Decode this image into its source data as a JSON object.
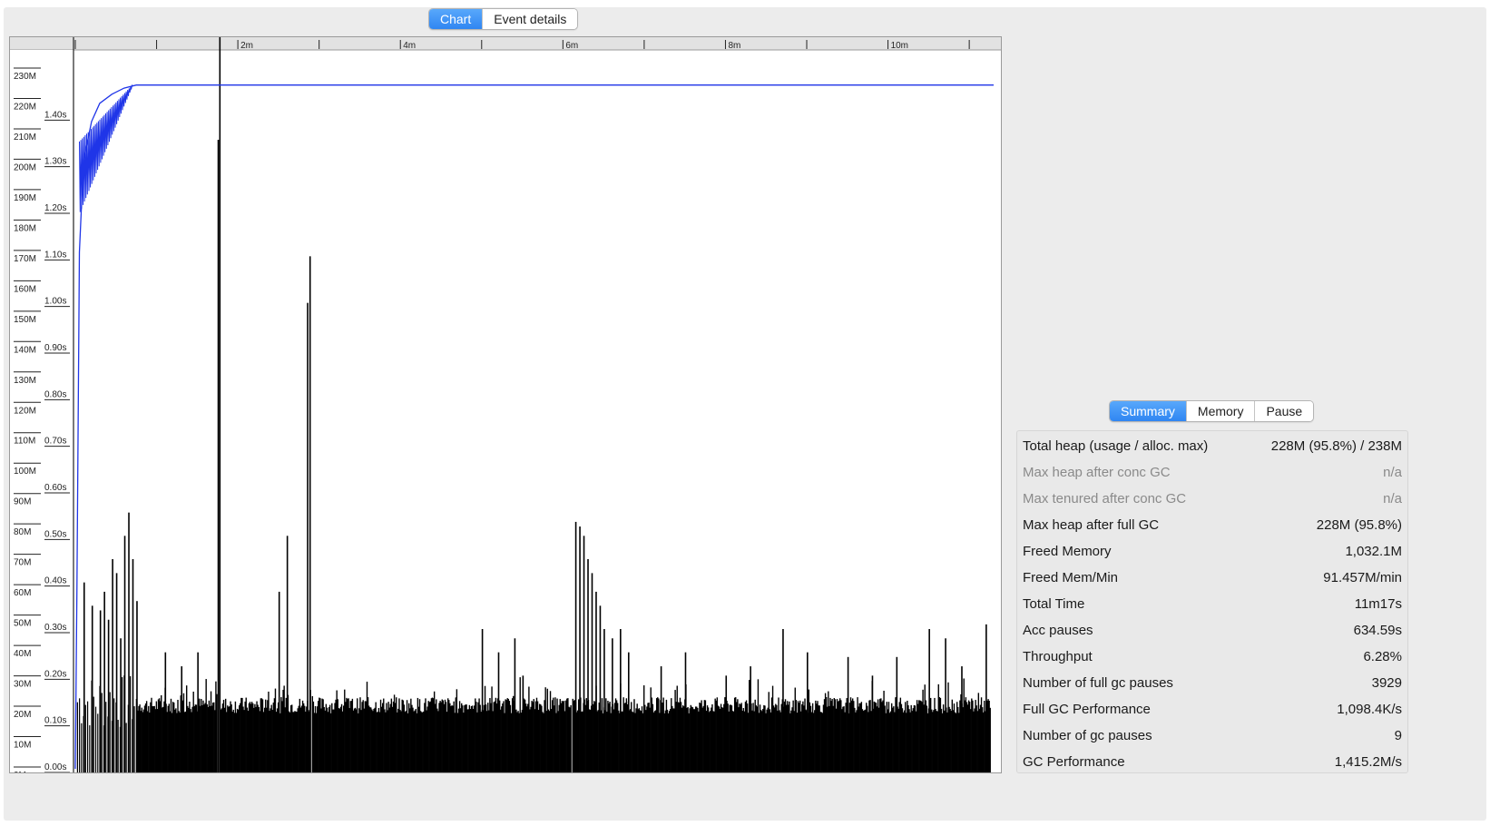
{
  "chart_tabs": [
    {
      "label": "Chart",
      "active": true
    },
    {
      "label": "Event details",
      "active": false
    }
  ],
  "summary_tabs": [
    {
      "label": "Summary",
      "active": true
    },
    {
      "label": "Memory",
      "active": false
    },
    {
      "label": "Pause",
      "active": false
    }
  ],
  "summary": {
    "rows": [
      {
        "label": "Total heap (usage / alloc. max)",
        "value": "228M (95.8%) / 238M",
        "dim": false
      },
      {
        "label": "Max heap after conc GC",
        "value": "n/a",
        "dim": true
      },
      {
        "label": "Max tenured after conc GC",
        "value": "n/a",
        "dim": true
      },
      {
        "label": "Max heap after full GC",
        "value": "228M (95.8%)",
        "dim": false
      },
      {
        "label": "Freed Memory",
        "value": "1,032.1M",
        "dim": false
      },
      {
        "label": "Freed Mem/Min",
        "value": "91.457M/min",
        "dim": false
      },
      {
        "label": "Total Time",
        "value": "11m17s",
        "dim": false
      },
      {
        "label": "Acc pauses",
        "value": "634.59s",
        "dim": false
      },
      {
        "label": "Throughput",
        "value": "6.28%",
        "dim": false
      },
      {
        "label": "Number of full gc pauses",
        "value": "3929",
        "dim": false
      },
      {
        "label": "Full GC Performance",
        "value": "1,098.4K/s",
        "dim": false
      },
      {
        "label": "Number of gc pauses",
        "value": "9",
        "dim": false
      },
      {
        "label": "GC Performance",
        "value": "1,415.2M/s",
        "dim": false
      }
    ]
  },
  "colors": {
    "accent": "#2f86f2",
    "heap_line": "#1f35e8",
    "pause_bars": "#000000"
  },
  "chart_data": {
    "type": "bar",
    "x_unit": "minutes",
    "xlim": [
      0,
      11.3
    ],
    "x_ticks": [
      "",
      "2m",
      "4m",
      "6m",
      "8m",
      "10m"
    ],
    "y_heap_ticks": [
      "0M",
      "10M",
      "20M",
      "30M",
      "40M",
      "50M",
      "60M",
      "70M",
      "80M",
      "90M",
      "100M",
      "110M",
      "120M",
      "130M",
      "140M",
      "150M",
      "160M",
      "170M",
      "180M",
      "190M",
      "200M",
      "210M",
      "220M",
      "230M"
    ],
    "y_heap_lim": [
      0,
      230
    ],
    "y_pause_ticks": [
      "0.00s",
      "0.10s",
      "0.20s",
      "0.30s",
      "0.40s",
      "0.50s",
      "0.60s",
      "0.70s",
      "0.80s",
      "0.90s",
      "1.00s",
      "1.10s",
      "1.20s",
      "1.30s",
      "1.40s"
    ],
    "y_pause_lim": [
      0,
      1.5
    ],
    "series": [
      {
        "kind": "line",
        "points": [
          [
            0.0,
            0
          ],
          [
            0.02,
            60
          ],
          [
            0.05,
            170
          ],
          [
            0.1,
            200
          ],
          [
            0.2,
            213
          ],
          [
            0.3,
            219
          ],
          [
            0.45,
            222
          ],
          [
            0.6,
            224
          ],
          [
            0.75,
            225
          ],
          [
            11.3,
            225
          ]
        ]
      },
      {
        "kind": "bars",
        "baseline": 0.14,
        "spikes": [
          [
            0.1,
            0.4
          ],
          [
            0.2,
            0.35
          ],
          [
            0.3,
            0.34
          ],
          [
            0.35,
            0.38
          ],
          [
            0.4,
            0.32
          ],
          [
            0.45,
            0.45
          ],
          [
            0.5,
            0.42
          ],
          [
            0.55,
            0.28
          ],
          [
            0.6,
            0.5
          ],
          [
            0.65,
            0.55
          ],
          [
            0.7,
            0.45
          ],
          [
            0.75,
            0.36
          ],
          [
            1.1,
            0.25
          ],
          [
            1.3,
            0.22
          ],
          [
            1.5,
            0.25
          ],
          [
            1.75,
            1.35
          ],
          [
            1.77,
            1.58
          ],
          [
            2.5,
            0.38
          ],
          [
            2.6,
            0.5
          ],
          [
            2.85,
            1.0
          ],
          [
            2.88,
            1.1
          ],
          [
            5.0,
            0.3
          ],
          [
            5.2,
            0.25
          ],
          [
            5.4,
            0.28
          ],
          [
            5.5,
            0.2
          ],
          [
            6.15,
            0.53
          ],
          [
            6.2,
            0.52
          ],
          [
            6.25,
            0.5
          ],
          [
            6.3,
            0.45
          ],
          [
            6.35,
            0.42
          ],
          [
            6.4,
            0.38
          ],
          [
            6.45,
            0.35
          ],
          [
            6.5,
            0.3
          ],
          [
            6.6,
            0.28
          ],
          [
            6.7,
            0.3
          ],
          [
            6.8,
            0.25
          ],
          [
            7.2,
            0.22
          ],
          [
            7.5,
            0.25
          ],
          [
            8.0,
            0.2
          ],
          [
            8.3,
            0.22
          ],
          [
            8.7,
            0.3
          ],
          [
            9.0,
            0.25
          ],
          [
            9.5,
            0.24
          ],
          [
            9.8,
            0.2
          ],
          [
            10.1,
            0.24
          ],
          [
            10.5,
            0.3
          ],
          [
            10.7,
            0.28
          ],
          [
            10.9,
            0.22
          ],
          [
            11.2,
            0.31
          ]
        ]
      }
    ]
  }
}
